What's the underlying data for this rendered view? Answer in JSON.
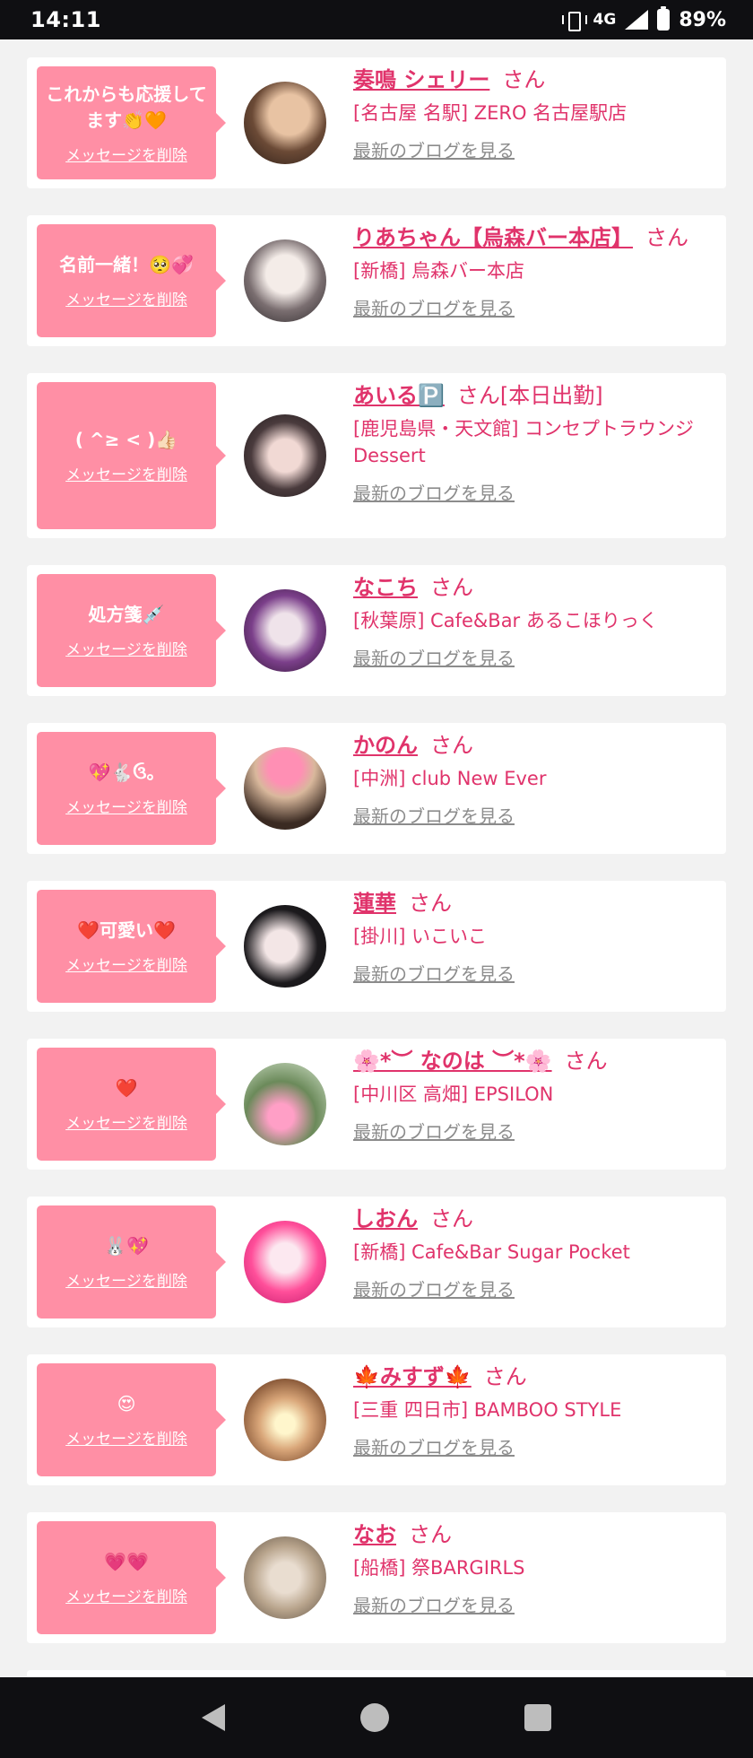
{
  "status_bar": {
    "time": "14:11",
    "network": "4G",
    "battery": "89%"
  },
  "delete_label": "メッセージを削除",
  "blog_label": "最新のブログを見る",
  "cards": [
    {
      "message": "これからも応援してます👏🧡",
      "name": "奏鳴 シェリー",
      "suffix": "さん",
      "shop": "[名古屋 名駅] ZERO 名古屋駅店"
    },
    {
      "message": "名前一緒！🥺💞",
      "name": "りあちゃん【烏森バー本店】",
      "suffix": "さん",
      "shop": "[新橋] 烏森バー本店"
    },
    {
      "message": "( ^≥ < )👍🏻",
      "name": "あいる🅿️",
      "suffix": "さん[本日出勤]",
      "shop": "[鹿児島県・天文館] コンセプトラウンジ Dessert"
    },
    {
      "message": "処方箋💉",
      "name": "なこち",
      "suffix": "さん",
      "shop": "[秋葉原] Cafe&Bar あるこほりっく"
    },
    {
      "message": "💖🐇ઉ。",
      "name": "かのん",
      "suffix": "さん",
      "shop": "[中洲] club New Ever"
    },
    {
      "message": "❤️可愛い❤️",
      "name": "蓮華",
      "suffix": "さん",
      "shop": "[掛川] いこいこ"
    },
    {
      "message": "❤️",
      "name": "🌸*︶ なのは ︶*🌸",
      "suffix": "さん",
      "shop": "[中川区 高畑] EPSILON"
    },
    {
      "message": "🐰💖",
      "name": "しおん",
      "suffix": "さん",
      "shop": "[新橋] Cafe&Bar Sugar Pocket"
    },
    {
      "message": "😍",
      "name": "🍁みすず🍁",
      "suffix": "さん",
      "shop": "[三重 四日市] BAMBOO STYLE"
    },
    {
      "message": "💗💗",
      "name": "なお",
      "suffix": "さん",
      "shop": "[船橋] 祭BARGIRLS"
    }
  ],
  "colors": {
    "bubble": "#ff8fa5",
    "accent": "#e0336b",
    "link_gray": "#8c8c8c"
  },
  "nav_icons": [
    "back-icon",
    "home-icon",
    "recents-icon"
  ]
}
